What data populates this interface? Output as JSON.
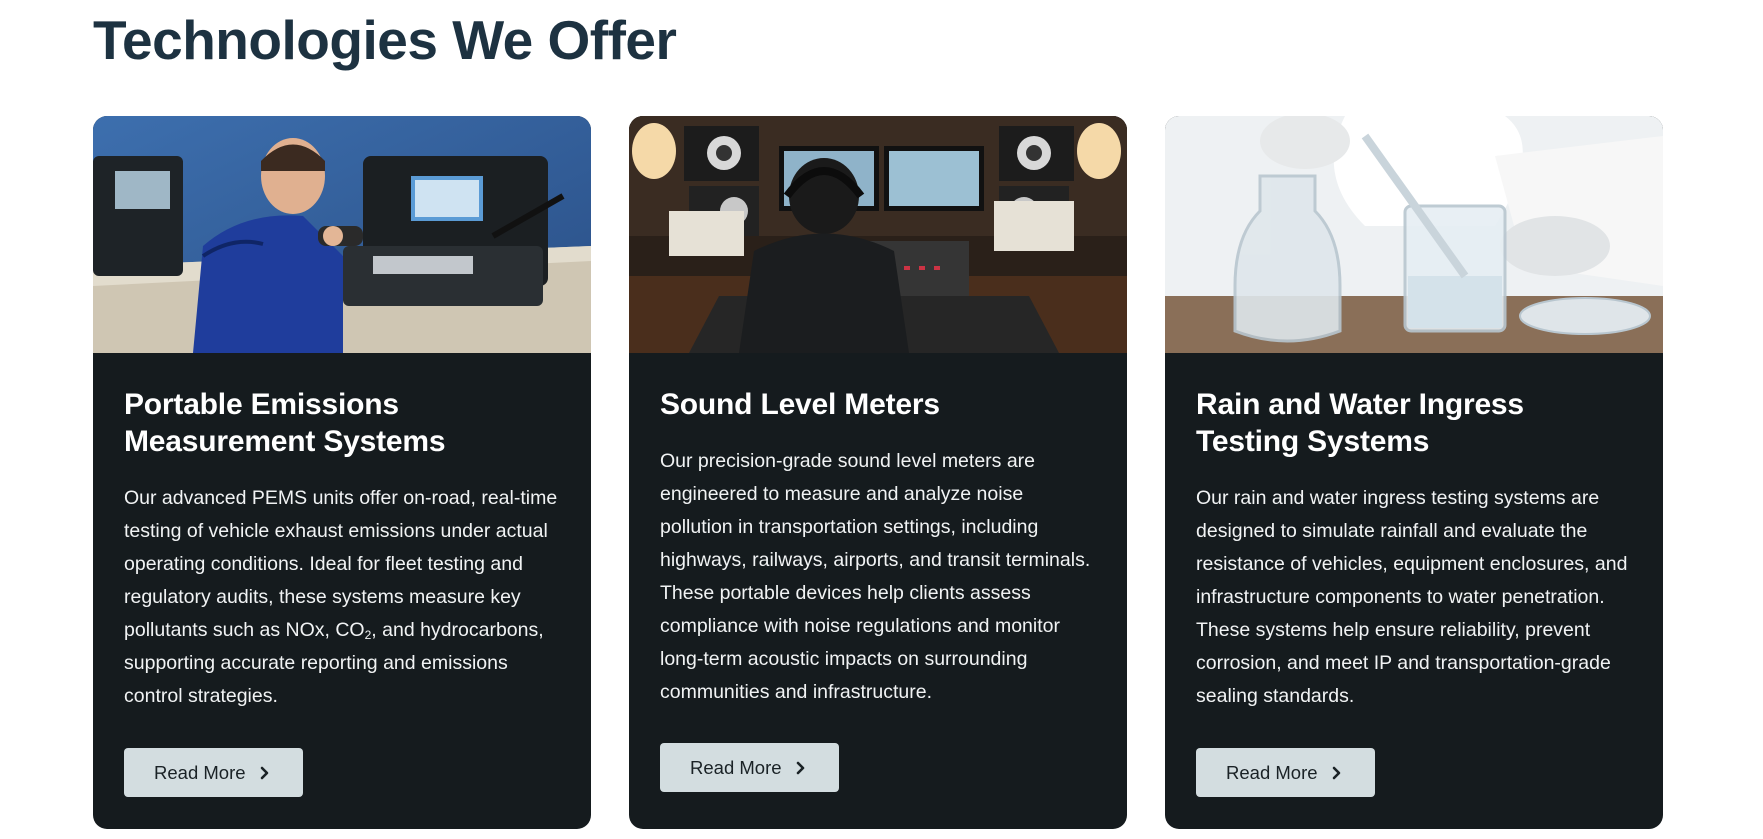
{
  "section": {
    "title": "Technologies We Offer"
  },
  "cards": [
    {
      "title_line1": "Portable Emissions",
      "title_line2": "Measurement Systems",
      "text_before": "Our advanced PEMS units offer on-road, real-time testing of vehicle exhaust emissions under actual operating conditions. Ideal for fleet testing and regulatory audits, these systems measure key pollutants such as NOx, CO",
      "text_sub": "2",
      "text_after": ", and hydrocarbons, supporting accurate reporting and emissions control strategies.",
      "button_label": "Read More",
      "image_icon": "photo-technician-emissions-analyzer"
    },
    {
      "title_line1": "Sound Level Meters",
      "text": "Our precision-grade sound level meters are engineered to measure and analyze noise pollution in transportation settings, including highways, railways, airports, and transit terminals. These portable devices help clients assess compliance with noise regulations and monitor long-term acoustic impacts on surrounding communities and infrastructure.",
      "button_label": "Read More",
      "image_icon": "photo-audio-mixing-studio"
    },
    {
      "title_line1": "Rain and Water Ingress",
      "title_line2": "Testing Systems",
      "text": "Our rain and water ingress testing systems are designed to simulate rainfall and evaluate the resistance of vehicles, equipment enclosures, and infrastructure components to water penetration. These systems help ensure reliability, prevent corrosion, and meet IP and transportation-grade sealing standards.",
      "button_label": "Read More",
      "image_icon": "photo-laboratory-glassware"
    }
  ],
  "colors": {
    "heading": "#1d3241",
    "card_bg": "#151b1e",
    "button_bg": "#d3dde0"
  }
}
